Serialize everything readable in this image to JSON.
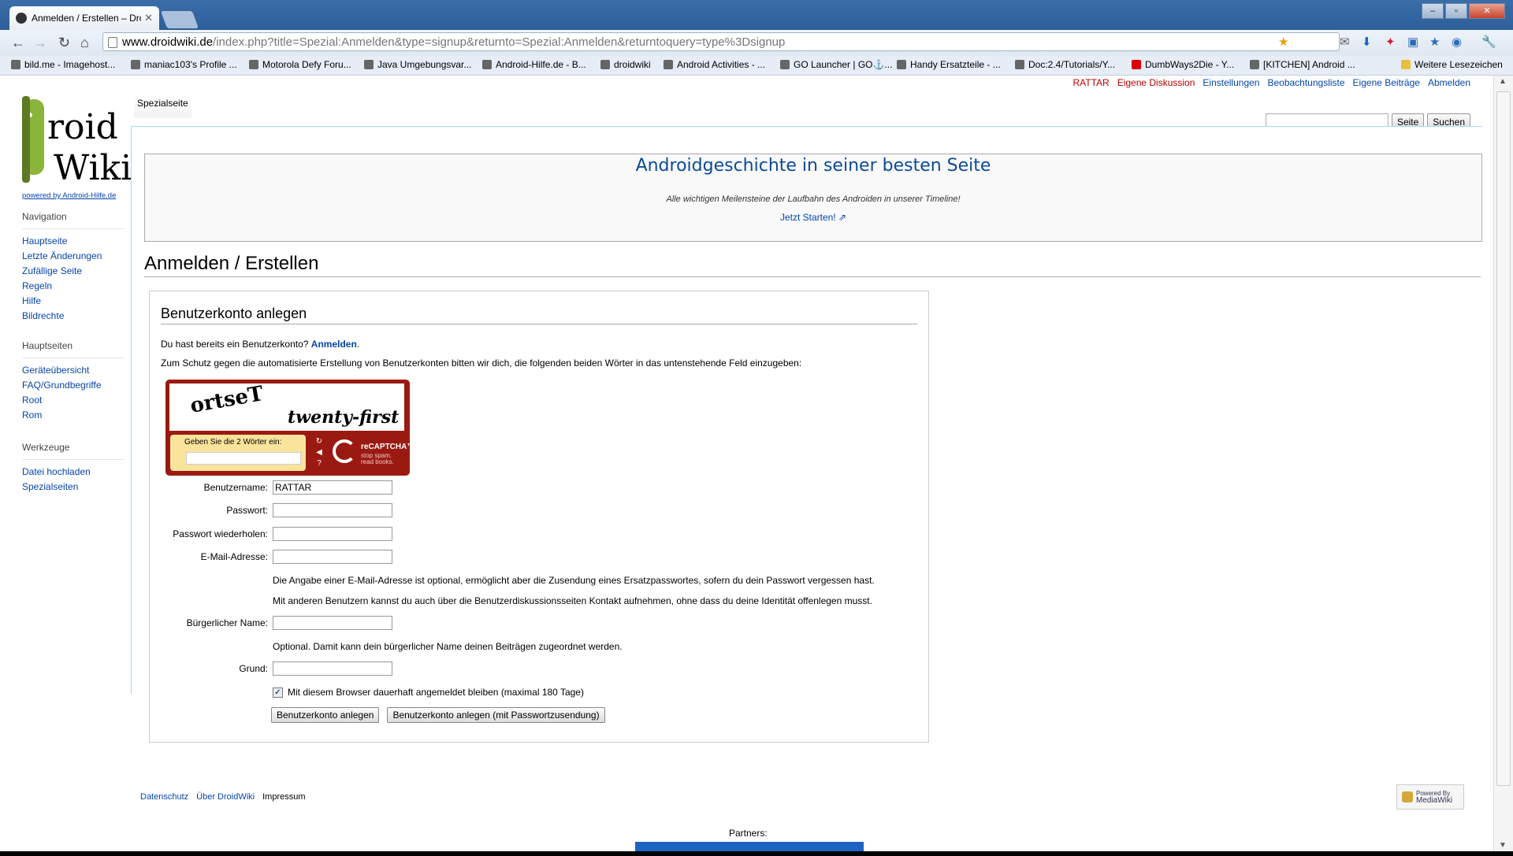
{
  "browser": {
    "tab_title": "Anmelden / Erstellen – Dro",
    "url_host": "www.droidwiki.de",
    "url_path": "/index.php?title=Spezial:Anmelden&type=signup&returnto=Spezial:Anmelden&returntoquery=type%3Dsignup",
    "bookmarks": [
      "bild.me - Imagehost...",
      "maniac103's Profile ...",
      "Motorola Defy Foru...",
      "Java Umgebungsvar...",
      "Android-Hilfe.de - B...",
      "droidwiki",
      "Android Activities - ...",
      "GO Launcher | GO⚓...",
      "Handy Ersatzteile - ...",
      "Doc:2.4/Tutorials/Y...",
      "DumbWays2Die - Y...",
      "[KITCHEN] Android ...",
      "Weitere Lesezeichen"
    ]
  },
  "personal": {
    "user": "RATTAR",
    "items": [
      "Eigene Diskussion",
      "Einstellungen",
      "Beobachtungsliste",
      "Eigene Beiträge",
      "Abmelden"
    ]
  },
  "logo": {
    "text1": "roid",
    "text2": "Wiki",
    "powered": "powered by Android-Hilfe.de"
  },
  "sidebar": {
    "navigation": {
      "title": "Navigation",
      "items": [
        "Hauptseite",
        "Letzte Änderungen",
        "Zufällige Seite",
        "Regeln",
        "Hilfe",
        "Bildrechte"
      ]
    },
    "hauptseiten": {
      "title": "Hauptseiten",
      "items": [
        "Geräteübersicht",
        "FAQ/Grundbegriffe",
        "Root",
        "Rom"
      ]
    },
    "werkzeuge": {
      "title": "Werkzeuge",
      "items": [
        "Datei hochladen",
        "Spezialseiten"
      ]
    }
  },
  "tabs": {
    "special": "Spezialseite"
  },
  "search": {
    "page_button": "Seite",
    "search_button": "Suchen"
  },
  "banner": {
    "title": "Androidgeschichte in seiner besten Seite",
    "subtitle": "Alle wichtigen Meilensteine der Laufbahn des Androiden in unserer Timeline!",
    "link": "Jetzt Starten!"
  },
  "heading": "Anmelden / Erstellen",
  "form": {
    "title": "Benutzerkonto anlegen",
    "have_account": "Du hast bereits ein Benutzerkonto?",
    "login_link": "Anmelden",
    "captcha_intro": "Zum Schutz gegen die automatisierte Erstellung von Benutzerkonten bitten wir dich, die folgenden beiden Wörter in das untenstehende Feld einzugeben:",
    "captcha": {
      "word1": "ortseT",
      "word2": "twenty-first",
      "prompt": "Geben Sie die 2 Wörter ein:",
      "brand": "reCAPTCHA™",
      "tagline1": "stop spam.",
      "tagline2": "read books."
    },
    "username_label": "Benutzername:",
    "username_value": "RATTAR",
    "password_label": "Passwort:",
    "password2_label": "Passwort wiederholen:",
    "email_label": "E-Mail-Adresse:",
    "email_note1": "Die Angabe einer E-Mail-Adresse ist optional, ermöglicht aber die Zusendung eines Ersatzpasswortes, sofern du dein Passwort vergessen hast.",
    "email_note2": "Mit anderen Benutzern kannst du auch über die Benutzerdiskussionsseiten Kontakt aufnehmen, ohne dass du deine Identität offenlegen musst.",
    "realname_label": "Bürgerlicher Name:",
    "realname_note": "Optional. Damit kann dein bürgerlicher Name deinen Beiträgen zugeordnet werden.",
    "reason_label": "Grund:",
    "remember_label": "Mit diesem Browser dauerhaft angemeldet bleiben (maximal 180 Tage)",
    "create_button": "Benutzerkonto anlegen",
    "create_mail_button": "Benutzerkonto anlegen (mit Passwortzusendung)"
  },
  "footer": {
    "items": [
      "Datenschutz",
      "Über DroidWiki",
      "Impressum"
    ],
    "powered_line1": "Powered By",
    "powered_line2": "MediaWiki",
    "partners": "Partners:"
  }
}
